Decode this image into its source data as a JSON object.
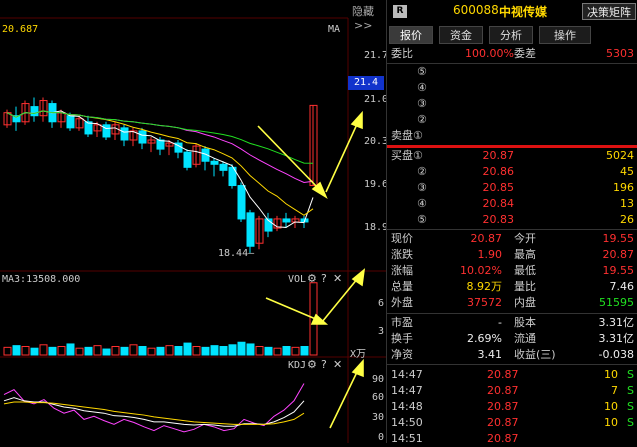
{
  "chart": {
    "ma_label_prefix": "20.687",
    "ma_tag": "MA",
    "hide_label": "隐藏",
    "hide_arrow": ">>",
    "price_axis": [
      "21.7",
      "21.4",
      "21.0",
      "20.3",
      "19.6",
      "18.9"
    ],
    "current_price_tag": "21.4",
    "low_label": "18.44",
    "vol_info": "MA3:13508.000",
    "vol_tag": "VOL",
    "vol_axis": [
      "6",
      "3",
      "X万"
    ],
    "kdj_tag": "KDJ",
    "kdj_axis": [
      "90",
      "60",
      "30",
      "0"
    ],
    "gear_icon": "⚙",
    "help_icon": "?",
    "close_icon": "✕",
    "colors": {
      "up": "#ff3030",
      "down": "#00e4ff",
      "arrow": "#ffff44",
      "ma5": "#ffffff",
      "ma10": "#ffd800",
      "ma20": "#ff44ff",
      "ma60": "#21e021"
    }
  },
  "header": {
    "badge": "R",
    "code": "600088",
    "name": "中视传媒",
    "decision_button": "决策矩阵"
  },
  "tabs": [
    "报价",
    "资金",
    "分析",
    "操作"
  ],
  "top_row": {
    "label1": "委比",
    "value1": "100.00%",
    "label2": "委差",
    "value2": "5303"
  },
  "sell_levels": [
    {
      "label": "⑤",
      "price": "",
      "vol": ""
    },
    {
      "label": "④",
      "price": "",
      "vol": ""
    },
    {
      "label": "③",
      "price": "",
      "vol": ""
    },
    {
      "label": "②",
      "price": "",
      "vol": ""
    },
    {
      "label": "卖盘①",
      "price": "",
      "vol": ""
    }
  ],
  "buy_levels": [
    {
      "label": "买盘①",
      "price": "20.87",
      "vol": "5024"
    },
    {
      "label": "②",
      "price": "20.86",
      "vol": "45"
    },
    {
      "label": "③",
      "price": "20.85",
      "vol": "196"
    },
    {
      "label": "④",
      "price": "20.84",
      "vol": "13"
    },
    {
      "label": "⑤",
      "price": "20.83",
      "vol": "26"
    }
  ],
  "quote": [
    {
      "l1": "现价",
      "v1": "20.87",
      "c1": "red",
      "l2": "今开",
      "v2": "19.55",
      "c2": "red"
    },
    {
      "l1": "涨跌",
      "v1": "1.90",
      "c1": "red",
      "l2": "最高",
      "v2": "20.87",
      "c2": "red"
    },
    {
      "l1": "涨幅",
      "v1": "10.02%",
      "c1": "red",
      "l2": "最低",
      "v2": "19.55",
      "c2": "red"
    },
    {
      "l1": "总量",
      "v1": "8.92万",
      "c1": "yellow",
      "l2": "量比",
      "v2": "7.46",
      "c2": "white"
    },
    {
      "l1": "外盘",
      "v1": "37572",
      "c1": "red",
      "l2": "内盘",
      "v2": "51595",
      "c2": "green"
    }
  ],
  "fundamentals": [
    {
      "l1": "市盈",
      "v1": "-",
      "l2": "股本",
      "v2": "3.31亿"
    },
    {
      "l1": "换手",
      "v1": "2.69%",
      "l2": "流通",
      "v2": "3.31亿"
    },
    {
      "l1": "净资",
      "v1": "3.41",
      "l2": "收益(三)",
      "v2": "-0.038"
    }
  ],
  "ticks": [
    {
      "time": "14:47",
      "price": "20.87",
      "vol": "10",
      "side": "S"
    },
    {
      "time": "14:47",
      "price": "20.87",
      "vol": "7",
      "side": "S"
    },
    {
      "time": "14:48",
      "price": "20.87",
      "vol": "10",
      "side": "S"
    },
    {
      "time": "14:50",
      "price": "20.87",
      "vol": "10",
      "side": "S"
    },
    {
      "time": "14:51",
      "price": "20.87",
      "vol": "",
      "side": ""
    }
  ]
}
